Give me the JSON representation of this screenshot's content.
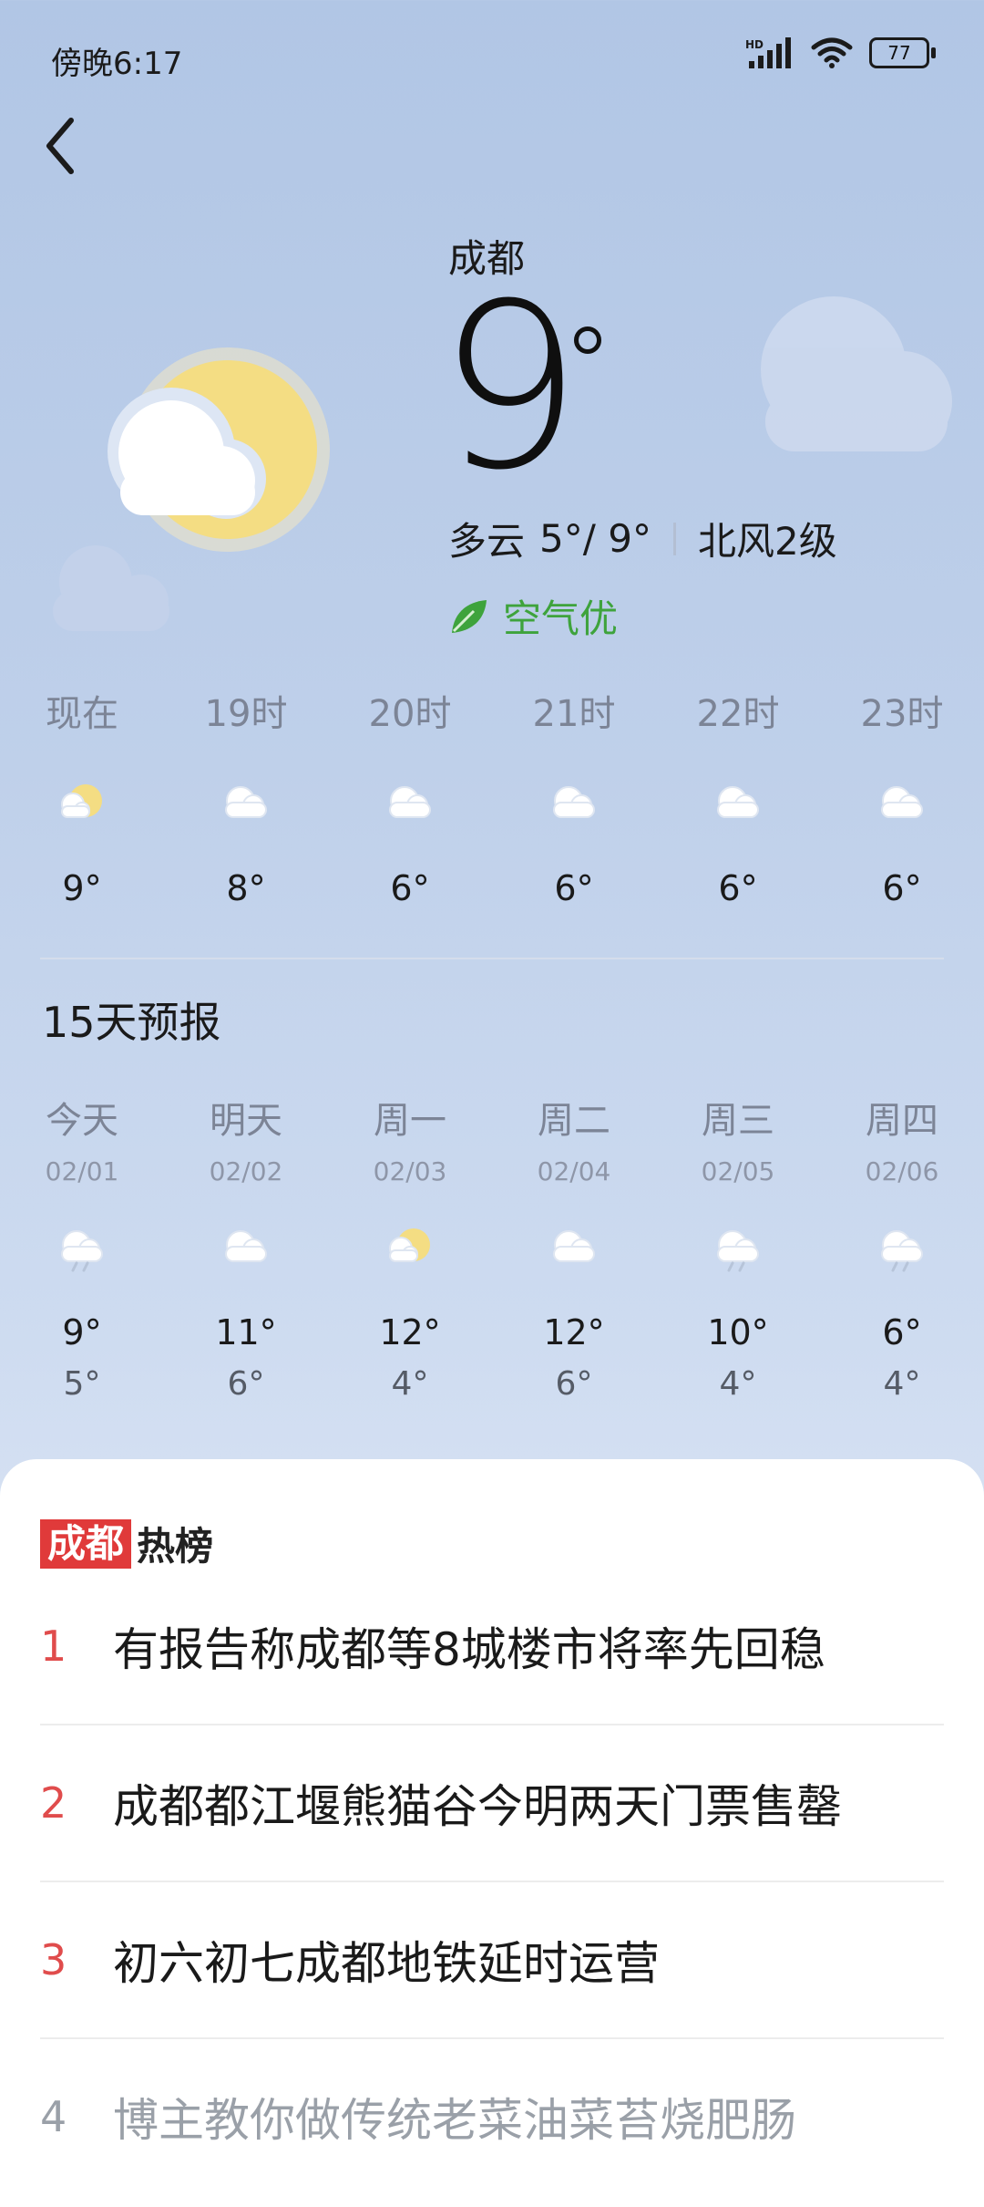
{
  "status_bar": {
    "time": "傍晚6:17",
    "battery": "77",
    "icons": [
      "hd-signal-icon",
      "wifi-icon",
      "battery-icon"
    ]
  },
  "current": {
    "city": "成都",
    "temp": "9",
    "condition": "多云",
    "range": "5°/ 9°",
    "wind": "北风2级",
    "aqi": "空气优",
    "aqi_color": "#3ea33c"
  },
  "hourly": [
    {
      "label": "现在",
      "temp": "9°",
      "icon": "sun-cloud-icon"
    },
    {
      "label": "19时",
      "temp": "8°",
      "icon": "cloud-icon"
    },
    {
      "label": "20时",
      "temp": "6°",
      "icon": "cloud-icon"
    },
    {
      "label": "21时",
      "temp": "6°",
      "icon": "cloud-icon"
    },
    {
      "label": "22时",
      "temp": "6°",
      "icon": "cloud-icon"
    },
    {
      "label": "23时",
      "temp": "6°",
      "icon": "cloud-icon"
    }
  ],
  "forecast": {
    "title": "15天预报",
    "days": [
      {
        "name": "今天",
        "date": "02/01",
        "high": "9°",
        "low": "5°",
        "icon": "rain-cloud-icon"
      },
      {
        "name": "明天",
        "date": "02/02",
        "high": "11°",
        "low": "6°",
        "icon": "cloud-icon"
      },
      {
        "name": "周一",
        "date": "02/03",
        "high": "12°",
        "low": "4°",
        "icon": "sun-cloud-icon"
      },
      {
        "name": "周二",
        "date": "02/04",
        "high": "12°",
        "low": "6°",
        "icon": "cloud-icon"
      },
      {
        "name": "周三",
        "date": "02/05",
        "high": "10°",
        "low": "4°",
        "icon": "rain-cloud-icon"
      },
      {
        "name": "周四",
        "date": "02/06",
        "high": "6°",
        "low": "4°",
        "icon": "rain-cloud-icon"
      }
    ]
  },
  "hot": {
    "logo_red": "成都",
    "logo_black": "热榜",
    "accent": "#e03a3a",
    "items": [
      {
        "rank": "1",
        "text": "有报告称成都等8城楼市将率先回稳"
      },
      {
        "rank": "2",
        "text": "成都都江堰熊猫谷今明两天门票售罄"
      },
      {
        "rank": "3",
        "text": "初六初七成都地铁延时运营"
      },
      {
        "rank": "4",
        "text": "博主教你做传统老菜油菜苔烧肥肠"
      }
    ]
  }
}
